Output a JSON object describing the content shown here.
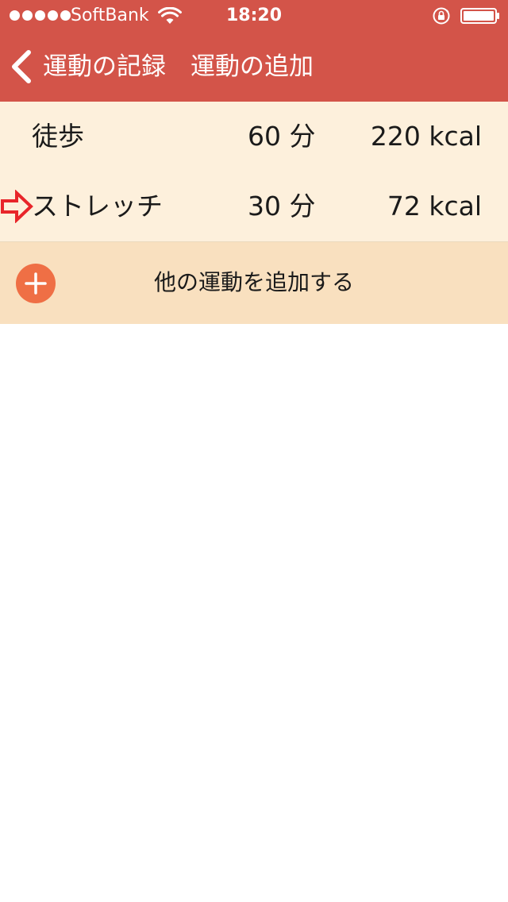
{
  "status_bar": {
    "carrier": "SoftBank",
    "time": "18:20",
    "icons": [
      "signal-dots",
      "wifi-icon",
      "rotation-lock-icon",
      "battery-icon"
    ]
  },
  "nav": {
    "back_label": "運動の記録",
    "title": "運動の追加",
    "back_icon": "chevron-left-icon"
  },
  "exercises": [
    {
      "name": "徒歩",
      "duration": "60 分",
      "calories": "220 kcal"
    },
    {
      "name": "ストレッチ",
      "duration": "30 分",
      "calories": "72 kcal"
    }
  ],
  "add_row": {
    "label": "他の運動を追加する",
    "icon": "plus-circle-icon"
  },
  "colors": {
    "header": "#d35449",
    "list_background": "#fdf0dc",
    "add_row_background": "#f9e0bf",
    "add_button": "#ef6f45",
    "pointer_arrow": "#e8252a",
    "text": "#1a1a1a",
    "page_background": "#ffffff"
  }
}
